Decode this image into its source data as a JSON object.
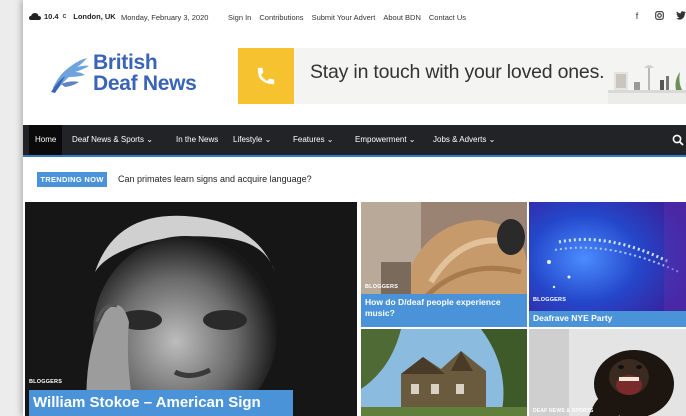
{
  "topbar": {
    "weather": {
      "temperature": "10.4",
      "unit": "C",
      "location": "London, UK",
      "icon": "cloud-icon"
    },
    "date": "Monday, February 3, 2020",
    "links": [
      {
        "label": "Sign In"
      },
      {
        "label": "Contributions"
      },
      {
        "label": "Submit Your Advert"
      },
      {
        "label": "About BDN"
      },
      {
        "label": "Contact Us"
      }
    ],
    "social": [
      {
        "name": "facebook-icon",
        "glyph": "f"
      },
      {
        "name": "instagram-icon",
        "glyph": "◙"
      },
      {
        "name": "twitter-icon",
        "glyph": "🐦"
      }
    ]
  },
  "logo": {
    "line1": "British",
    "line2": "Deaf News"
  },
  "banner": {
    "text": "Stay in touch with your loved ones."
  },
  "nav": {
    "items": [
      {
        "label": "Home",
        "active": true
      },
      {
        "label": "Deaf News & Sports ⌄"
      },
      {
        "label": "In the News"
      },
      {
        "label": "Lifestyle ⌄"
      },
      {
        "label": "Features ⌄"
      },
      {
        "label": "Empowerment ⌄"
      },
      {
        "label": "Jobs & Adverts ⌄"
      }
    ]
  },
  "trending": {
    "label": "TRENDING NOW",
    "headline": "Can primates learn signs and acquire language?"
  },
  "grid": {
    "featured": {
      "category": "BLOGGERS",
      "title": "William Stokoe – American Sign"
    },
    "tile1": {
      "category": "BLOGGERS",
      "title": "How do D/deaf people experience music?"
    },
    "tile2": {
      "category": "BLOGGERS",
      "title": "Deafrave NYE Party"
    },
    "tile4": {
      "category": "DEAF NEWS & SPORTS"
    }
  },
  "colors": {
    "accent": "#4a93d8",
    "logo": "#3a64b8",
    "nav": "#222326",
    "banner": "#f7c22f"
  }
}
